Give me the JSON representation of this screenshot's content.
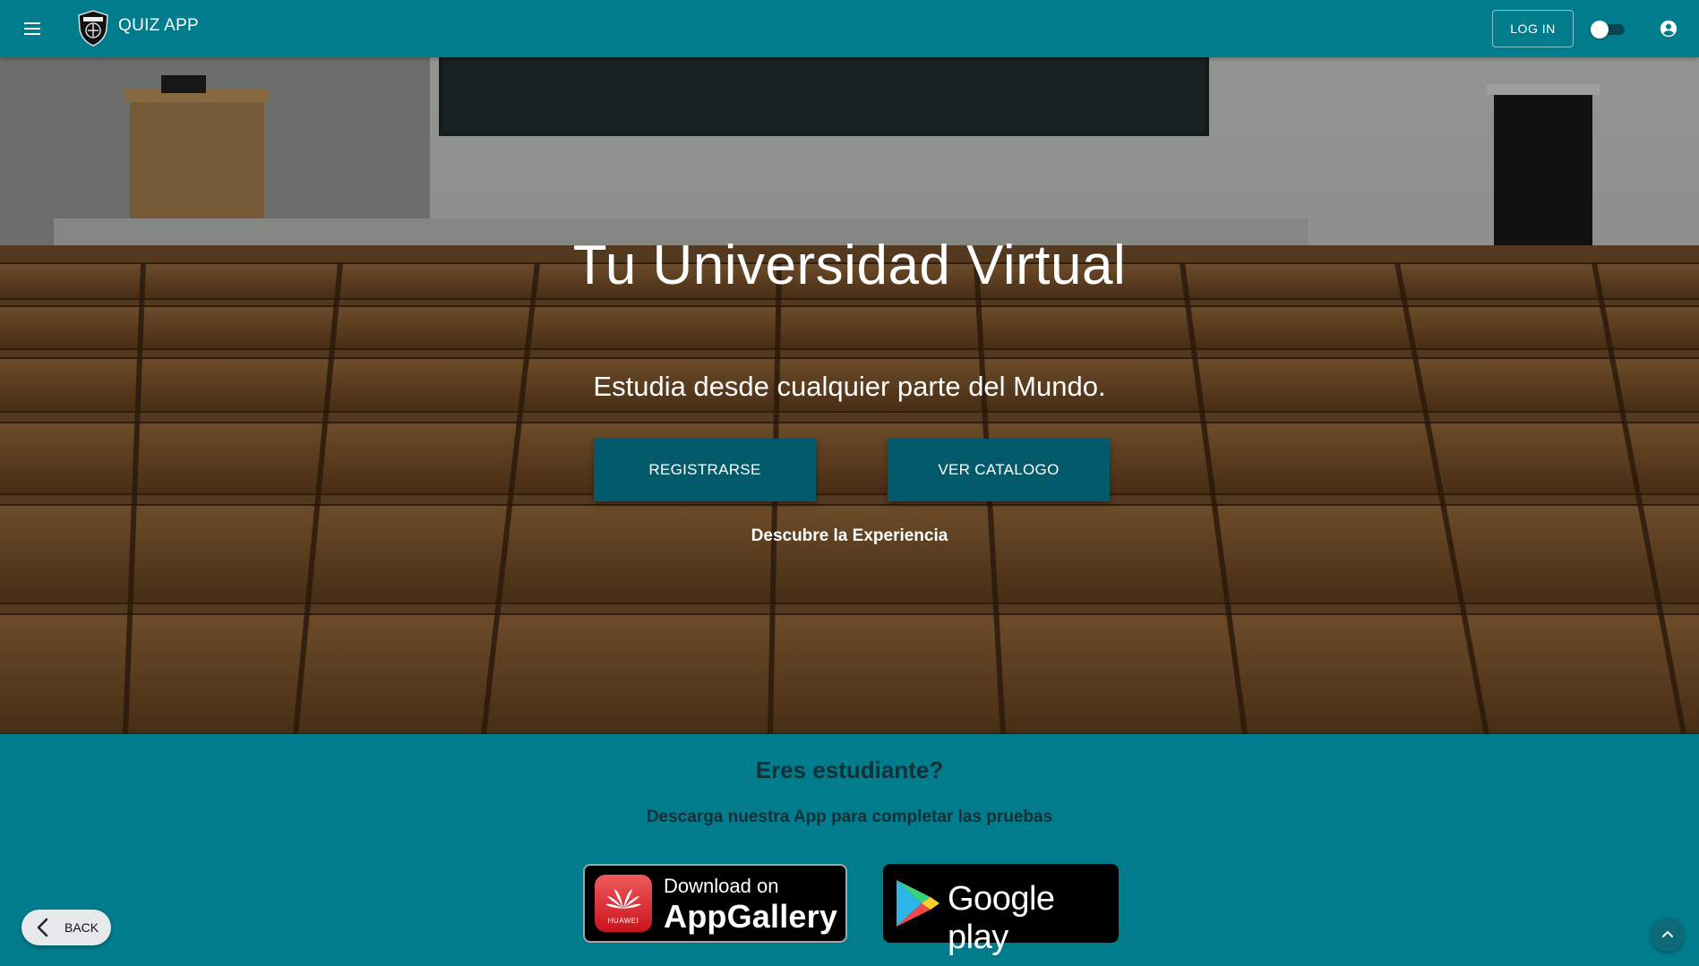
{
  "appbar": {
    "title": "QUIZ APP",
    "menu_icon": "menu-icon",
    "logo_icon": "shield-logo-icon",
    "login_label": "LOG IN",
    "theme_toggle_on": false,
    "account_icon": "account-circle-icon"
  },
  "hero": {
    "background": "lecture-hall-photo",
    "title": "Tu Universidad Virtual",
    "subtitle": "Estudia desde cualquier parte del Mundo.",
    "register_label": "REGISTRARSE",
    "catalog_label": "VER CATALOGO",
    "discover_text": "Descubre la Experiencia"
  },
  "student": {
    "title": "Eres estudiante?",
    "subtitle": "Descarga nuestra App para completar las pruebas",
    "appgallery": {
      "small_text": "Download on",
      "big_text": "AppGallery",
      "brand": "HUAWEI",
      "icon": "huawei-logo-icon"
    },
    "googleplay": {
      "text": "Google play",
      "icon": "google-play-icon"
    }
  },
  "back_label": "BACK",
  "colors": {
    "primary": "#007c8c",
    "button_dark": "#035a6a",
    "heading_text": "#123036"
  }
}
